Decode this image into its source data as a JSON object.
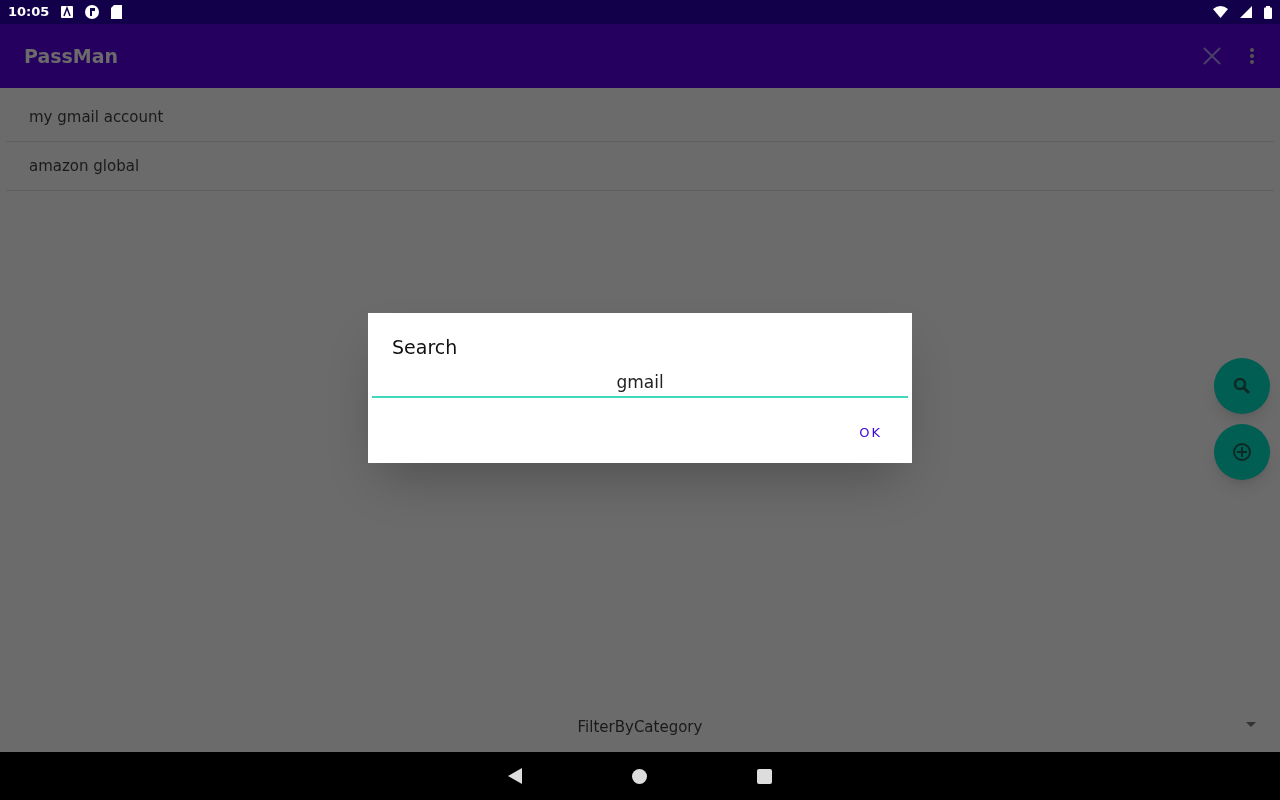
{
  "status_bar": {
    "time": "10:05"
  },
  "app_bar": {
    "title": "PassMan"
  },
  "entries": [
    {
      "label": "my gmail account"
    },
    {
      "label": "amazon global"
    }
  ],
  "dialog": {
    "title": "Search",
    "field": {
      "value": "gmail"
    },
    "buttons": [
      "OK"
    ]
  },
  "filter": {
    "label": "FilterByCategory"
  }
}
